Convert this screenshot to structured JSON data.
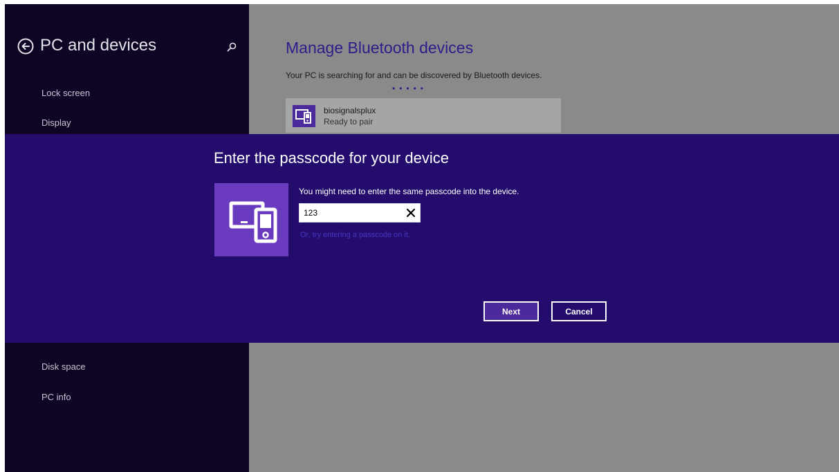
{
  "sidebar": {
    "title": "PC and devices",
    "back_icon": "back-arrow-icon",
    "search_icon": "search-icon",
    "items": [
      {
        "label": "Lock screen"
      },
      {
        "label": "Display"
      },
      {
        "label": "Disk space"
      },
      {
        "label": "PC info"
      }
    ]
  },
  "main": {
    "title": "Manage Bluetooth devices",
    "subtitle": "Your PC is searching for and can be discovered by Bluetooth devices.",
    "progress_dots": "•••••",
    "device": {
      "name": "biosignalsplux",
      "status": "Ready to pair",
      "icon": "devices-icon"
    }
  },
  "dialog": {
    "title": "Enter the passcode for your device",
    "message": "You might need to enter the same passcode into the device.",
    "passcode_value": "123",
    "clear_icon": "close-icon",
    "alt_link": "Or, try entering a passcode on it.",
    "next_label": "Next",
    "cancel_label": "Cancel",
    "icon": "devices-icon"
  },
  "colors": {
    "sidebar_bg": "#0e0524",
    "content_bg": "#8a8a8a",
    "dialog_bg": "#230c6b",
    "accent": "#4b2a9c",
    "title_color": "#2f1b8a"
  }
}
